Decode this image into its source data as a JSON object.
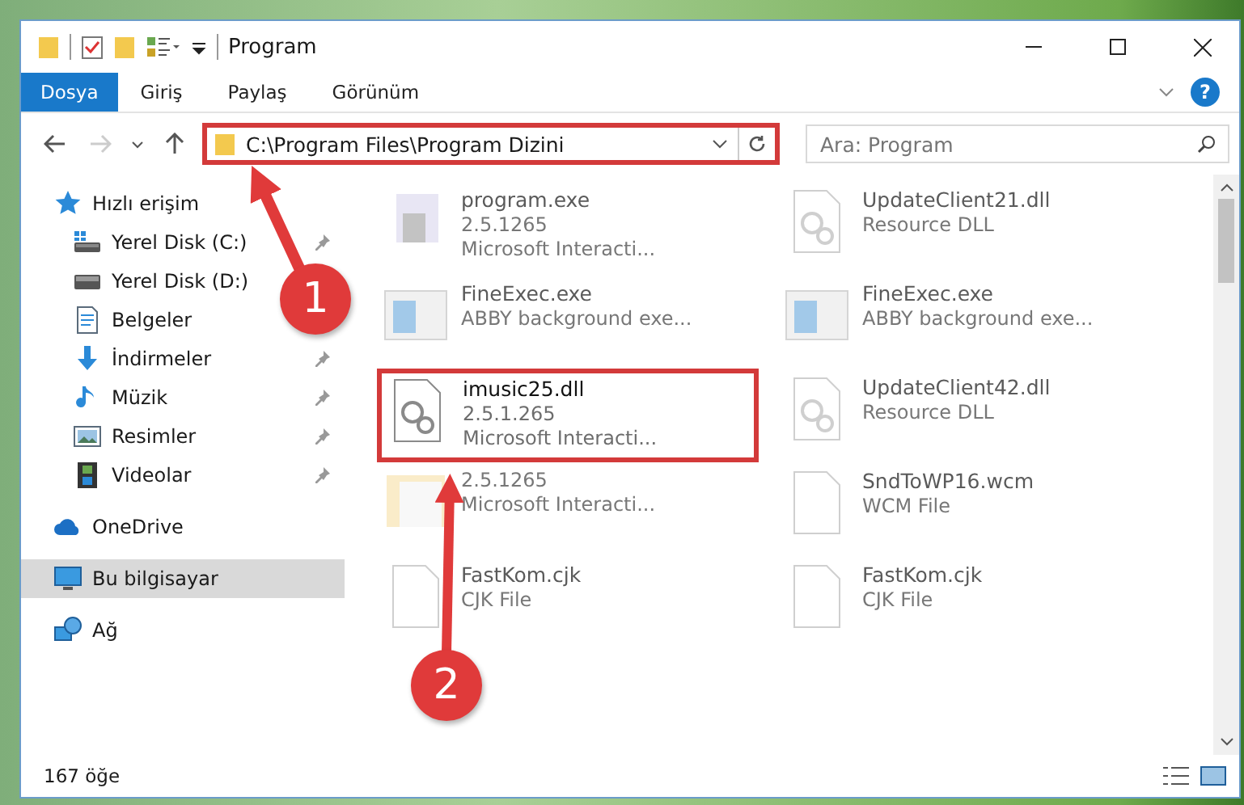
{
  "window": {
    "title": "Program"
  },
  "ribbon_tabs": [
    {
      "label": "Dosya",
      "selected": true
    },
    {
      "label": "Giriş",
      "selected": false
    },
    {
      "label": "Paylaş",
      "selected": false
    },
    {
      "label": "Görünüm",
      "selected": false
    }
  ],
  "help": "?",
  "address": {
    "path": "C:\\Program Files\\Program Dizini",
    "highlighted": true
  },
  "search": {
    "placeholder": "Ara: Program"
  },
  "sidebar": {
    "items": [
      {
        "label": "Hızlı erişim",
        "kind": "star",
        "selected": false,
        "children": [
          {
            "label": "Yerel Disk (C:)",
            "kind": "drive-win",
            "pinned": true,
            "selected": false
          },
          {
            "label": "Yerel Disk (D:)",
            "kind": "drive",
            "pinned": false,
            "selected": false
          },
          {
            "label": "Belgeler",
            "kind": "document",
            "pinned": false,
            "selected": false
          },
          {
            "label": "İndirmeler",
            "kind": "download",
            "pinned": true,
            "selected": false
          },
          {
            "label": "Müzik",
            "kind": "music",
            "pinned": true,
            "selected": false
          },
          {
            "label": "Resimler",
            "kind": "picture",
            "pinned": true,
            "selected": false
          },
          {
            "label": "Videolar",
            "kind": "film",
            "pinned": true,
            "selected": false
          }
        ]
      },
      {
        "label": "OneDrive",
        "kind": "cloud",
        "selected": false
      },
      {
        "label": "Bu bilgisayar",
        "kind": "monitor",
        "selected": true
      },
      {
        "label": "Ağ",
        "kind": "network",
        "selected": false
      }
    ]
  },
  "files": [
    {
      "kind": "app",
      "name": "program.exe",
      "details": [
        "2.5.1265",
        "Microsoft Interacti..."
      ],
      "faded": true,
      "highlighted": false
    },
    {
      "kind": "dll",
      "name": "UpdateClient21.dll",
      "details": [
        "Resource DLL"
      ],
      "faded": true,
      "highlighted": false
    },
    {
      "kind": "window",
      "name": "FineExec.exe",
      "details": [
        "ABBY background exe..."
      ],
      "faded": true,
      "highlighted": false
    },
    {
      "kind": "window",
      "name": "FineExec.exe",
      "details": [
        "ABBY background exe..."
      ],
      "faded": true,
      "highlighted": false
    },
    {
      "kind": "dll",
      "name": "imusic25.dll",
      "details": [
        "2.5.1.265",
        "Microsoft Interacti..."
      ],
      "faded": false,
      "highlighted": true
    },
    {
      "kind": "dll",
      "name": "UpdateClient42.dll",
      "details": [
        "Resource DLL"
      ],
      "faded": true,
      "highlighted": false
    },
    {
      "kind": "folder-doc",
      "details": [
        "2.5.1265",
        "Microsoft Interacti..."
      ],
      "faded": true,
      "highlighted": false
    },
    {
      "kind": "blank",
      "name": "SndToWP16.wcm",
      "details": [
        "WCM File"
      ],
      "faded": true,
      "highlighted": false
    },
    {
      "kind": "blank",
      "name": "FastKom.cjk",
      "details": [
        "CJK File"
      ],
      "faded": true,
      "highlighted": false
    },
    {
      "kind": "blank",
      "name": "FastKom.cjk",
      "details": [
        "CJK File"
      ],
      "faded": true,
      "highlighted": false
    }
  ],
  "status_bar": {
    "item_count": "167 öğe"
  },
  "annotations": [
    {
      "label": "1"
    },
    {
      "label": "2"
    }
  ]
}
